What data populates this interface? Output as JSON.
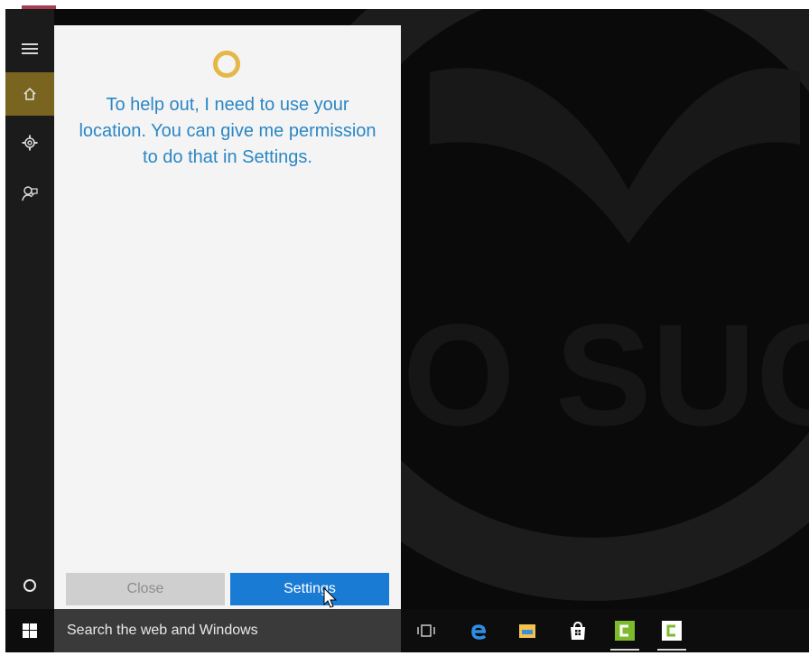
{
  "cortana": {
    "message": "To help out, I need to use your location. You can give me permission to do that in Settings.",
    "close_label": "Close",
    "settings_label": "Settings"
  },
  "taskbar": {
    "search_placeholder": "Search the web and Windows",
    "pinned_icons": [
      "task-view-icon",
      "edge-icon",
      "file-explorer-icon",
      "store-icon",
      "camtasia-icon",
      "camtasia-icon"
    ]
  },
  "left_rail": {
    "items": [
      "hamburger-menu-icon",
      "home-icon",
      "gear-icon",
      "feedback-icon",
      "cortana-circle-icon"
    ]
  },
  "colors": {
    "cortana_blue": "#2a87c5",
    "settings_button": "#1a7bd4",
    "home_active": "#7a6520",
    "cortana_ring": "#e5b746",
    "camtasia_green": "#7dbb2d"
  }
}
